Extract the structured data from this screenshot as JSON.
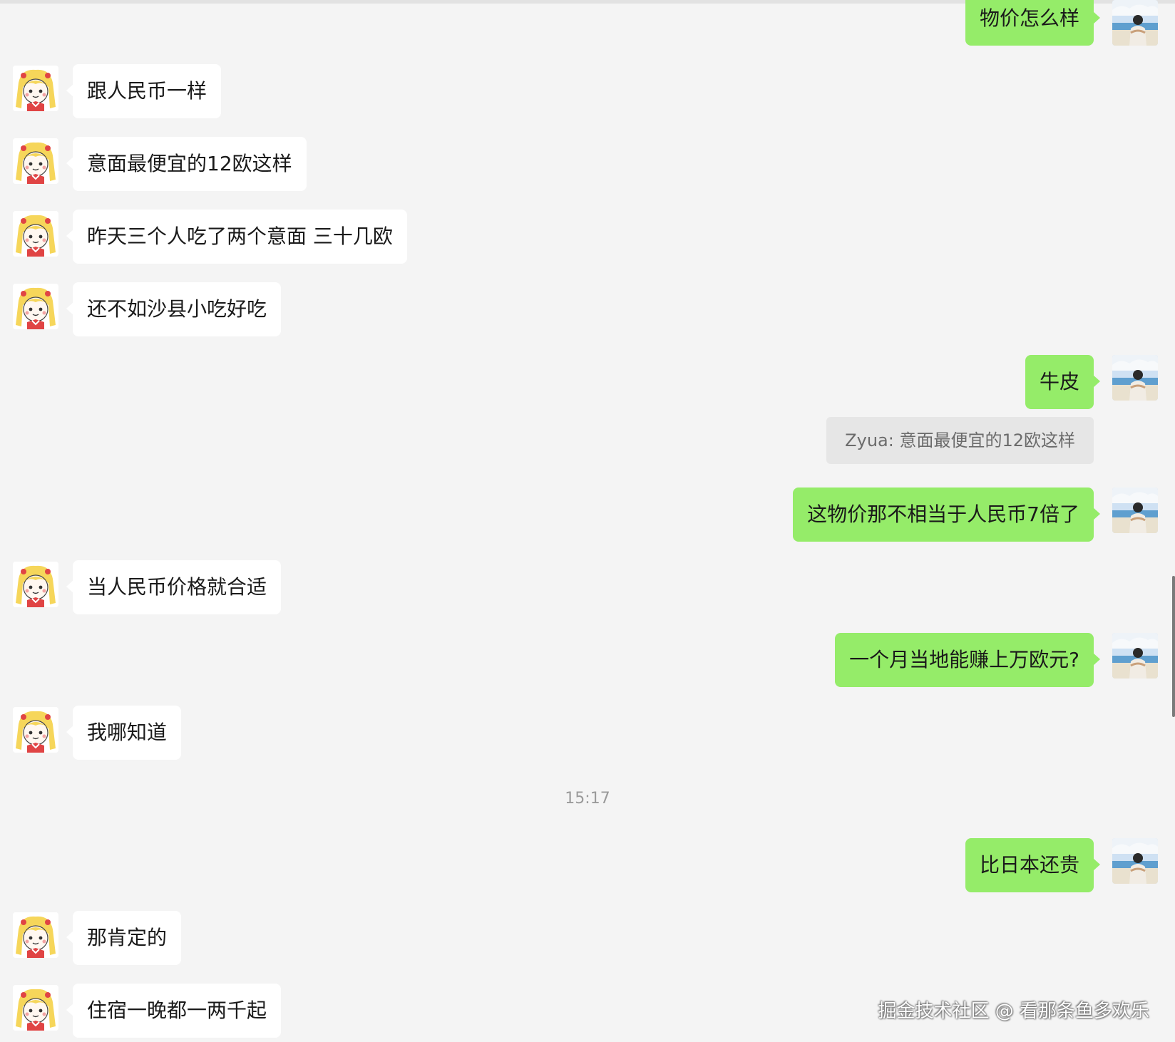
{
  "messages": [
    {
      "side": "out",
      "text": "物价怎么样"
    },
    {
      "side": "in",
      "text": "跟人民币一样"
    },
    {
      "side": "in",
      "text": "意面最便宜的12欧这样"
    },
    {
      "side": "in",
      "text": "昨天三个人吃了两个意面 三十几欧"
    },
    {
      "side": "in",
      "text": "还不如沙县小吃好吃"
    },
    {
      "side": "out",
      "text": "牛皮"
    },
    {
      "quote": "Zyua: 意面最便宜的12欧这样"
    },
    {
      "side": "out",
      "text": "这物价那不相当于人民币7倍了"
    },
    {
      "side": "in",
      "text": "当人民币价格就合适"
    },
    {
      "side": "out",
      "text": "一个月当地能赚上万欧元?"
    },
    {
      "side": "in",
      "text": "我哪知道"
    },
    {
      "timestamp": "15:17"
    },
    {
      "side": "out",
      "text": "比日本还贵"
    },
    {
      "side": "in",
      "text": "那肯定的"
    },
    {
      "side": "in",
      "text": "住宿一晚都一两千起"
    }
  ],
  "watermark": "掘金技术社区 @ 看那条鱼多欢乐",
  "colors": {
    "background": "#f4f4f4",
    "incoming_bubble": "#ffffff",
    "outgoing_bubble": "#95ec69",
    "quote_bubble": "#e6e6e6"
  },
  "icons": {
    "contact_avatar": "anime-girl-avatar",
    "own_avatar": "beach-person-avatar"
  }
}
